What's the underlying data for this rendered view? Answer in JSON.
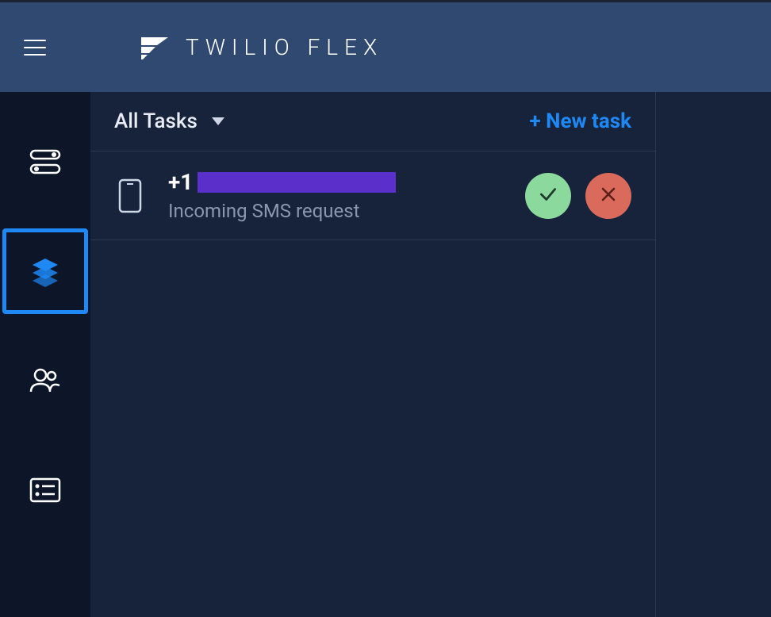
{
  "header": {
    "brand_name": "TWILIO FLEX"
  },
  "sidebar": {
    "items": [
      {
        "name": "status",
        "active": false
      },
      {
        "name": "tasks",
        "active": true
      },
      {
        "name": "team",
        "active": false
      },
      {
        "name": "list",
        "active": false
      }
    ]
  },
  "task_panel": {
    "filter_label": "All Tasks",
    "new_task_label": "+ New task",
    "tasks": [
      {
        "phone_prefix": "+1",
        "phone_redacted": true,
        "subtitle": "Incoming SMS request",
        "type": "sms"
      }
    ]
  },
  "colors": {
    "accent": "#1e88f5",
    "accept": "#8bd99d",
    "reject": "#d96a5c",
    "redacted": "#5b2fc9"
  }
}
